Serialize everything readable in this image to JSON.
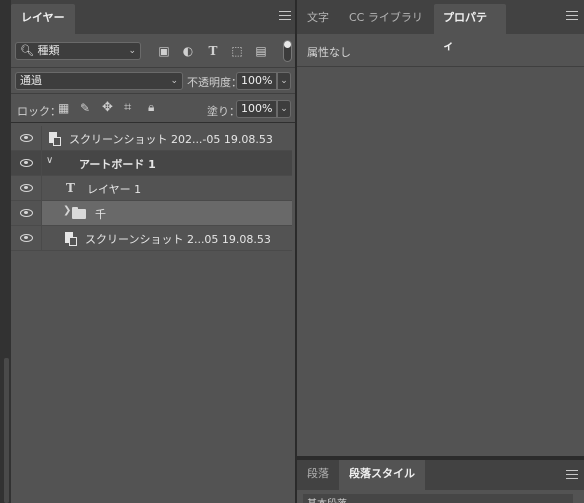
{
  "layers_panel": {
    "tab_label": "レイヤー",
    "filter": {
      "kind_label": "種類",
      "kind_icon": "search-icon"
    },
    "filter_icons": [
      "image-filter-icon",
      "adjustment-filter-icon",
      "type-filter-icon",
      "shape-filter-icon",
      "smart-object-filter-icon"
    ],
    "blend_mode": "通過",
    "opacity_label": "不透明度：",
    "opacity_value": "100%",
    "lock_label": "ロック：",
    "fill_label": "塗り：",
    "fill_value": "100%",
    "layers": [
      {
        "name": "スクリーンショット 202...-05 19.08.53",
        "kind": "smart-object",
        "visible": true
      },
      {
        "name": "アートボード 1",
        "kind": "artboard",
        "visible": true
      },
      {
        "name": "レイヤー 1",
        "kind": "type",
        "visible": true
      },
      {
        "name": "千",
        "kind": "group",
        "visible": true,
        "selected": true
      },
      {
        "name": "スクリーンショット 2...05 19.08.53",
        "kind": "smart-object",
        "visible": true
      }
    ]
  },
  "right_panel": {
    "tabs": [
      "文字",
      "CC ライブラリ",
      "プロパティ"
    ],
    "active_tab": "プロパティ",
    "properties_text": "属性なし",
    "bottom_tabs": [
      "段落",
      "段落スタイル"
    ],
    "bottom_active_tab": "段落スタイル",
    "paragraph_style_item": "基本段落"
  },
  "colors": {
    "panel_bg": "#535353",
    "tabbar_bg": "#424242",
    "selected_row": "#696969",
    "artboard_row": "#464646"
  }
}
